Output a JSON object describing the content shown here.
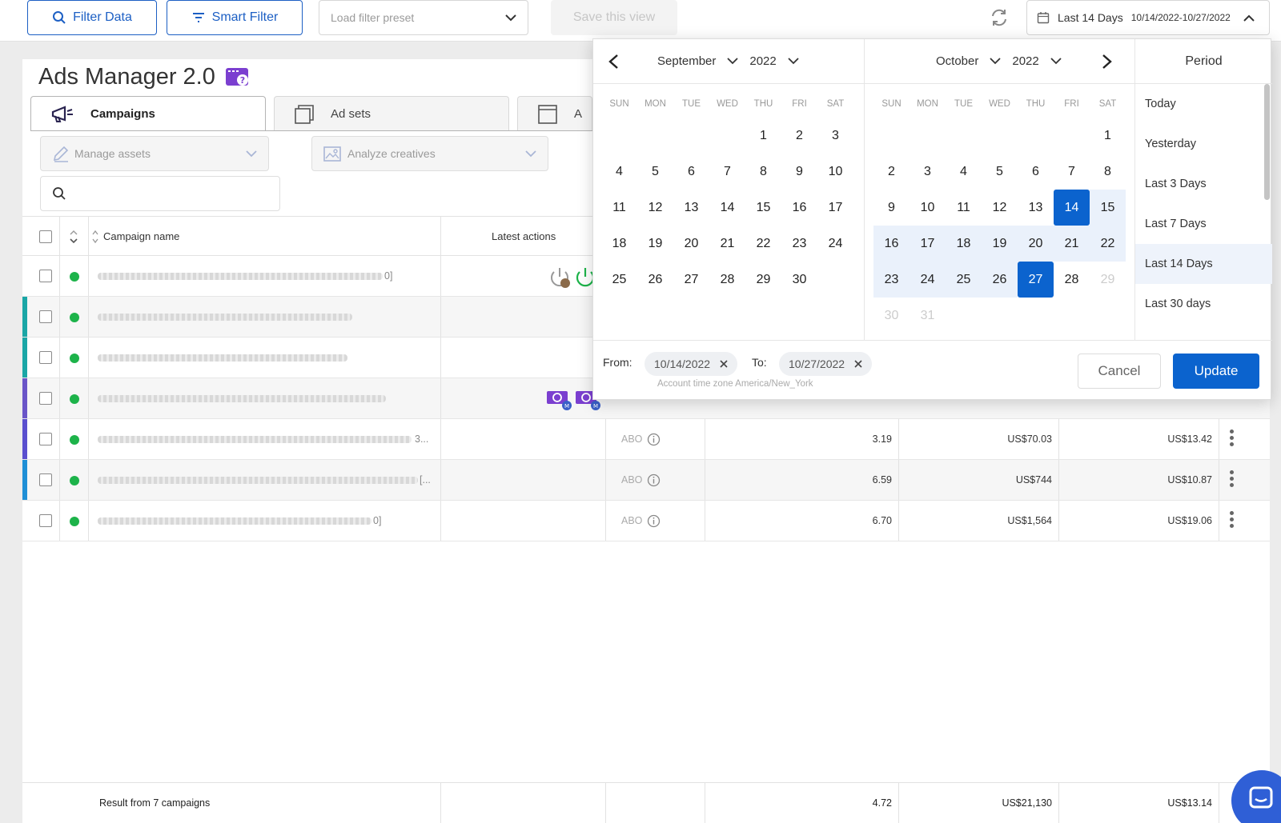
{
  "toolbar": {
    "filter_data": "Filter Data",
    "smart_filter": "Smart Filter",
    "preset_placeholder": "Load filter preset",
    "save_view": "Save this view",
    "date_label": "Last 14 Days",
    "date_range": "10/14/2022-10/27/2022"
  },
  "app": {
    "title": "Ads Manager 2.0",
    "tabs": [
      {
        "label": "Campaigns"
      },
      {
        "label": "Ad sets"
      },
      {
        "label": "A"
      }
    ],
    "manage_assets": "Manage assets",
    "analyze_creatives": "Analyze creatives"
  },
  "table": {
    "headers": {
      "campaign_name": "Campaign name",
      "latest_actions": "Latest actions"
    },
    "rows": [
      {
        "status": "active",
        "accent": "",
        "budget": "",
        "v1": "",
        "v2": "",
        "v3": ""
      },
      {
        "status": "active",
        "accent": "#1aa6a6",
        "budget": "",
        "v1": "",
        "v2": "",
        "v3": ""
      },
      {
        "status": "active",
        "accent": "#1aa6a6",
        "budget": "",
        "v1": "",
        "v2": "",
        "v3": ""
      },
      {
        "status": "active",
        "accent": "#6a55c8",
        "budget": "",
        "v1": "",
        "v2": "",
        "v3": ""
      },
      {
        "status": "active",
        "accent": "#5a4fcf",
        "budget": "ABO",
        "v1": "3.19",
        "v2": "US$70.03",
        "v3": "US$13.42",
        "name_suffix": "3..."
      },
      {
        "status": "active",
        "accent": "#1f8fd6",
        "budget": "ABO",
        "v1": "6.59",
        "v2": "US$744",
        "v3": "US$10.87",
        "name_suffix": "[..."
      },
      {
        "status": "active",
        "accent": "",
        "budget": "ABO",
        "v1": "6.70",
        "v2": "US$1,564",
        "v3": "US$19.06",
        "name_suffix": "0]"
      }
    ],
    "row1_suffix": "0]",
    "footer": {
      "label": "Result from 7 campaigns",
      "v1": "4.72",
      "v2": "US$21,130",
      "v3": "US$13.14"
    }
  },
  "picker": {
    "left": {
      "month": "September",
      "year": "2022"
    },
    "right": {
      "month": "October",
      "year": "2022"
    },
    "weekdays": [
      "SUN",
      "MON",
      "TUE",
      "WED",
      "THU",
      "FRI",
      "SAT"
    ],
    "period_title": "Period",
    "periods": [
      "Today",
      "Yesterday",
      "Last 3 Days",
      "Last 7 Days",
      "Last 14 Days",
      "Last 30 days"
    ],
    "active_period": "Last 14 Days",
    "from_label": "From:",
    "from_value": "10/14/2022",
    "to_label": "To:",
    "to_value": "10/27/2022",
    "timezone": "Account time zone America/New_York",
    "cancel": "Cancel",
    "update": "Update"
  },
  "colors": {
    "accent": "#0b63ce",
    "status_active": "#1db34a",
    "brand": "#1c5fc4"
  }
}
